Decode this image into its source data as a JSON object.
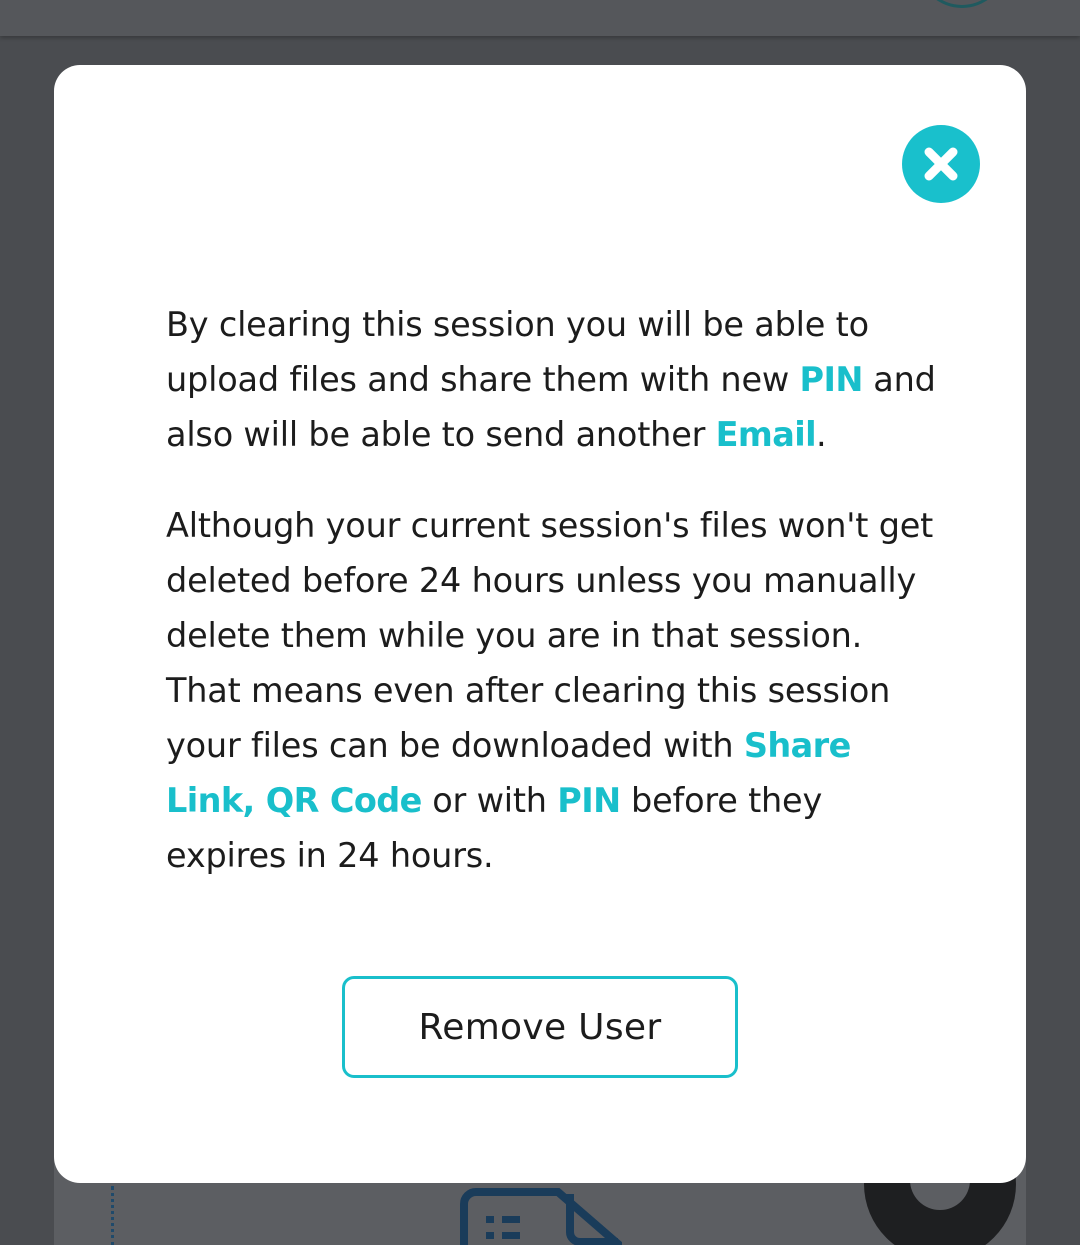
{
  "modal": {
    "paragraph1": {
      "t1": "By clearing this session you will be able to upload files and share them with new ",
      "hl_pin": "PIN",
      "t2": " and also will be able to send another ",
      "hl_email": "Email",
      "t3": "."
    },
    "paragraph2": {
      "t1": "Although your current session's files won't get deleted before 24 hours unless you manually delete them while you are in that session. That means even after clearing this session your files can be downloaded with ",
      "hl_share": "Share Link, QR Code",
      "t2": " or with ",
      "hl_pin": "PIN",
      "t3": " before they expires in 24 hours."
    },
    "remove_button_label": "Remove User"
  },
  "colors": {
    "accent": "#19bfcb",
    "overlay": "#4a4c50",
    "modal_bg": "#ffffff",
    "text": "#1c1c1c"
  },
  "icons": {
    "close": "close-x-icon",
    "background_document": "document-icon"
  }
}
